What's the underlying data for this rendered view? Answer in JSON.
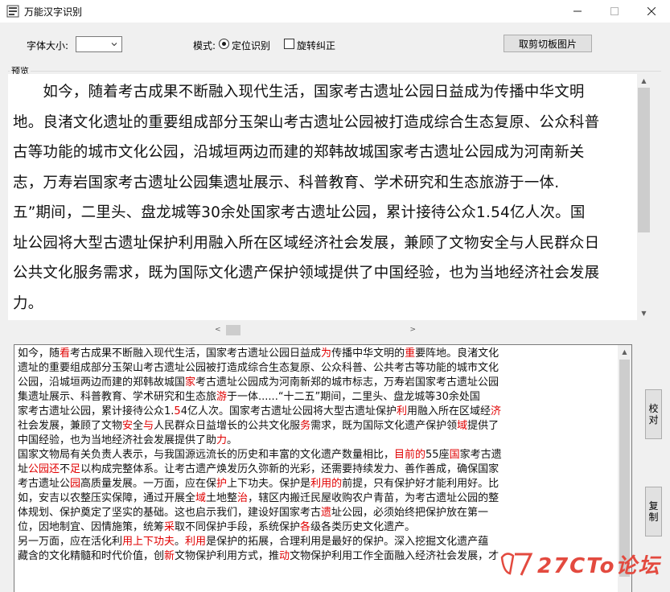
{
  "window": {
    "title": "万能汉字识别",
    "minimize_icon": "minimize-icon",
    "maximize_icon": "maximize-icon",
    "close_icon": "close-icon"
  },
  "toolbar": {
    "font_size_label": "字体大小:",
    "font_size_value": "",
    "mode_label": "模式:",
    "mode_option": "定位识别",
    "rotate_label": "旋转纠正",
    "rotate_checked": false,
    "crop_button": "取剪切板图片"
  },
  "preview": {
    "label": "预览",
    "lines": [
      "　　如今，随着考古成果不断融入现代生活，国家考古遗址公园日益成为传播中华文明",
      "地。良渚文化遗址的重要组成部分玉架山考古遗址公园被打造成综合生态复原、公众科普",
      "古等功能的城市文化公园，沿城垣两边而建的郑韩故城国家考古遗址公园成为河南新关",
      "志，万寿岩国家考古遗址公园集遗址展示、科普教育、学术研究和生态旅游于一体.",
      "五”期间，二里头、盘龙城等30余处国家考古遗址公园，累计接待公众1.54亿人次。国",
      "址公园将大型古遗址保护利用融入所在区域经济社会发展，兼顾了文物安全与人民群众日",
      "公共文化服务需求，既为国际文化遗产保护领域提供了中国经验，也为当地经济社会发展",
      "力。"
    ]
  },
  "result": {
    "lines": [
      [
        [
          "如今，随",
          0
        ],
        [
          "看",
          1
        ],
        [
          "考古成果不断融入现代生活，国家考古遗址公园日益成",
          0
        ],
        [
          "为",
          1
        ],
        [
          "传播中华文明的",
          0
        ],
        [
          "重",
          1
        ],
        [
          "要阵地。良渚文化",
          0
        ]
      ],
      [
        [
          "遗址的重要组成部分玉架山考古遗址公园被打造成综合生态复原、公众科普、公共考古等功能的城市文化",
          0
        ]
      ],
      [
        [
          "公园，沿城垣两边而建的郑韩故城国",
          0
        ],
        [
          "家",
          1
        ],
        [
          "考古遗址公园成为河南新郑的城市标志，万寿岩国家考古遗址公园",
          0
        ]
      ],
      [
        [
          "集遗址展示、科普教育、学术研究和生态旅",
          0
        ],
        [
          "游",
          1
        ],
        [
          "于一体......“十二五”期间，二里头、盘龙城等30余处国",
          0
        ]
      ],
      [
        [
          "家考古遗址公园，累计接待公众1.",
          0
        ],
        [
          "5",
          1
        ],
        [
          "4亿人次。国家考古遗址公园将大型古遗址保护",
          0
        ],
        [
          "利",
          1
        ],
        [
          "用融入所在区域经",
          0
        ],
        [
          "济",
          1
        ]
      ],
      [
        [
          "社会发展，兼顾了文物",
          0
        ],
        [
          "安",
          1
        ],
        [
          "全",
          0
        ],
        [
          "与",
          1
        ],
        [
          "人民群众日益增长的公共文化服",
          0
        ],
        [
          "务",
          1
        ],
        [
          "需求，既为国际文化遗产保护领",
          0
        ],
        [
          "域",
          1
        ],
        [
          "提供了",
          0
        ]
      ],
      [
        [
          "中国经验，也为当地经济社会发展提供了助",
          0
        ],
        [
          "力",
          1
        ],
        [
          "。",
          0
        ]
      ],
      [
        [
          "国家文物局有关负责人表示，与我国源远流长的历史和丰富的文化遗产数量相比，",
          0
        ],
        [
          "目前的",
          1
        ],
        [
          "55座",
          0
        ],
        [
          "国",
          1
        ],
        [
          "家考古遗",
          0
        ]
      ],
      [
        [
          "址",
          0
        ],
        [
          "公园还",
          1
        ],
        [
          "不",
          0
        ],
        [
          "足",
          1
        ],
        [
          "以构成完整体系。让考古遗产焕发历久弥新的光彩，还需要持续发力、善作善成，确保国家",
          0
        ]
      ],
      [
        [
          "考古遗址公",
          0
        ],
        [
          "园",
          1
        ],
        [
          "高质量发展。一万面，应在保",
          0
        ],
        [
          "护",
          1
        ],
        [
          "上下功夫。保护是",
          0
        ],
        [
          "利用的",
          1
        ],
        [
          "前提，只有保护好才能利用好。比",
          0
        ]
      ],
      [
        [
          "如，安吉以农整压实保障，通过开展全",
          0
        ],
        [
          "域",
          1
        ],
        [
          "土地整",
          0
        ],
        [
          "治",
          1
        ],
        [
          "，辖区内搬迁民屋收购农户青苗，为考古遗址公园的整",
          0
        ]
      ],
      [
        [
          "体规划、保护奠定了坚实的基础。这也启示我们，建设好国家考古",
          0
        ],
        [
          "遗",
          1
        ],
        [
          "址公园，必须始终把保护放在第一",
          0
        ]
      ],
      [
        [
          "位，因地制宜、因情施策，统筹",
          0
        ],
        [
          "采",
          1
        ],
        [
          "取不同保护手段，系统保护",
          0
        ],
        [
          "各",
          1
        ],
        [
          "级各类历史文化遗产。",
          0
        ]
      ],
      [
        [
          "另一万面，应在活化利",
          0
        ],
        [
          "用上下功夫",
          1
        ],
        [
          "。",
          0
        ],
        [
          "利用",
          1
        ],
        [
          "是保护的拓展，合理利用是最好的保护。深入挖掘文化遗产蕴",
          0
        ]
      ],
      [
        [
          "藏含的文化精髓和时代价值，创",
          0
        ],
        [
          "新",
          1
        ],
        [
          "文物保护利用方式，推",
          0
        ],
        [
          "动",
          1
        ],
        [
          "文物保护利用工作全面融入经济社会发展，才",
          0
        ]
      ]
    ]
  },
  "side_buttons": {
    "check": [
      "校",
      "对"
    ],
    "copy": [
      "复",
      "制"
    ]
  },
  "watermark": {
    "text": "27CTo论坛"
  },
  "colors": {
    "highlight": "#e00000",
    "window_bg": "#f0f0f0"
  }
}
